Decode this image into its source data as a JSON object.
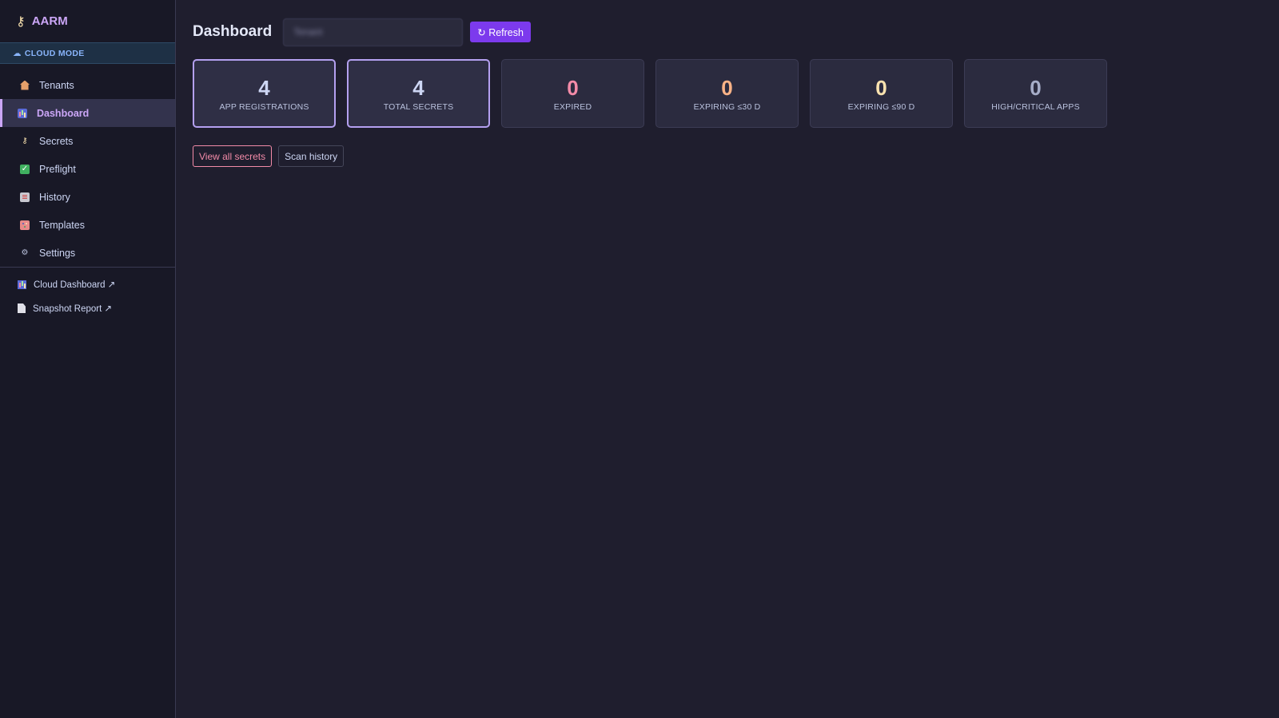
{
  "sidebar": {
    "brand": "AARM",
    "mode_banner": "CLOUD MODE",
    "nav_items": [
      {
        "label": "Tenants",
        "icon": "house-icon",
        "active": false
      },
      {
        "label": "Dashboard",
        "icon": "bar-chart-icon",
        "active": true
      },
      {
        "label": "Secrets",
        "icon": "key-icon",
        "active": false
      },
      {
        "label": "Preflight",
        "icon": "checkmark-icon",
        "active": false
      },
      {
        "label": "History",
        "icon": "clipboard-icon",
        "active": false
      },
      {
        "label": "Templates",
        "icon": "palette-icon",
        "active": false
      },
      {
        "label": "Settings",
        "icon": "gear-icon",
        "active": false
      }
    ],
    "external_links": [
      {
        "label": "Cloud Dashboard ↗",
        "icon": "bar-chart-icon"
      },
      {
        "label": "Snapshot Report ↗",
        "icon": "document-icon"
      }
    ]
  },
  "header": {
    "title": "Dashboard",
    "tenant_value": "Tenant",
    "refresh_label": "↻ Refresh"
  },
  "stats": [
    {
      "value": "4",
      "label": "APP REGISTRATIONS",
      "color": "#cdd6f4"
    },
    {
      "value": "4",
      "label": "TOTAL SECRETS",
      "color": "#cdd6f4"
    },
    {
      "value": "0",
      "label": "EXPIRED",
      "color": "#f38ba8"
    },
    {
      "value": "0",
      "label": "EXPIRING ≤30 D",
      "color": "#fab387"
    },
    {
      "value": "0",
      "label": "EXPIRING ≤90 D",
      "color": "#f9e2af"
    },
    {
      "value": "0",
      "label": "HIGH/CRITICAL APPS",
      "color": "#a6adc8"
    }
  ],
  "actions": {
    "view_all_secrets": "View all secrets",
    "scan_history": "Scan history"
  },
  "colors": {
    "accent": "#cba6f7",
    "primary_button": "#7c3aed",
    "background": "#1f1e2e",
    "sidebar": "#181826"
  }
}
